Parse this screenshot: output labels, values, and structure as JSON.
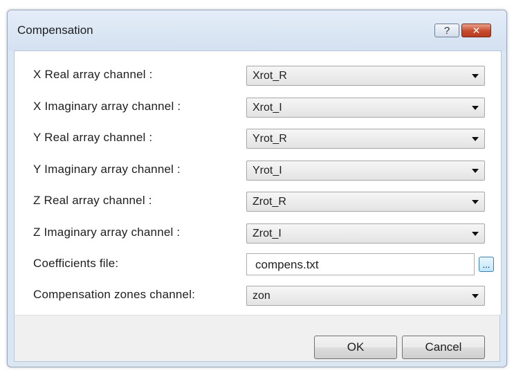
{
  "window": {
    "title": "Compensation",
    "help_label": "?",
    "close_label": "✕"
  },
  "form": {
    "rows": [
      {
        "label": "X Real array channel :",
        "value": "Xrot_R"
      },
      {
        "label": "X Imaginary array channel :",
        "value": "Xrot_I"
      },
      {
        "label": "Y Real array channel :",
        "value": "Yrot_R"
      },
      {
        "label": "Y Imaginary array channel :",
        "value": "Yrot_I"
      },
      {
        "label": "Z Real array channel :",
        "value": "Zrot_R"
      },
      {
        "label": "Z Imaginary array channel :",
        "value": "Zrot_I"
      }
    ],
    "coefficients": {
      "label": "Coefficients file:",
      "value": "compens.txt",
      "browse_label": "..."
    },
    "zones": {
      "label": "Compensation zones channel:",
      "value": "zon"
    }
  },
  "footer": {
    "ok_label": "OK",
    "cancel_label": "Cancel"
  }
}
